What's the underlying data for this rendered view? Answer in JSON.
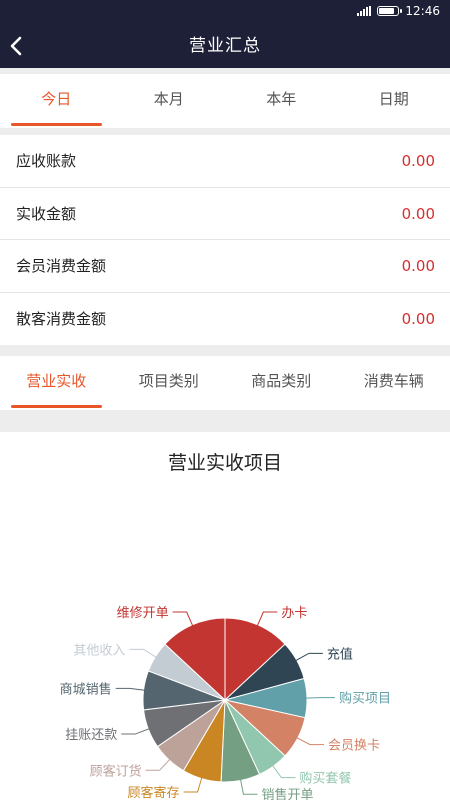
{
  "status": {
    "time": "12:46"
  },
  "header": {
    "title": "营业汇总"
  },
  "date_tabs": [
    {
      "label": "今日",
      "active": true
    },
    {
      "label": "本月",
      "active": false
    },
    {
      "label": "本年",
      "active": false
    },
    {
      "label": "日期",
      "active": false
    }
  ],
  "summary": [
    {
      "label": "应收账款",
      "value": "0.00"
    },
    {
      "label": "实收金额",
      "value": "0.00"
    },
    {
      "label": "会员消费金额",
      "value": "0.00"
    },
    {
      "label": "散客消费金额",
      "value": "0.00"
    }
  ],
  "category_tabs": [
    {
      "label": "营业实收",
      "active": true
    },
    {
      "label": "项目类别",
      "active": false
    },
    {
      "label": "商品类别",
      "active": false
    },
    {
      "label": "消费车辆",
      "active": false
    }
  ],
  "chart_data": {
    "type": "pie",
    "title": "营业实收项目",
    "legend": "none",
    "series": [
      {
        "name": "办卡",
        "value": 17,
        "color": "#c23531"
      },
      {
        "name": "充值",
        "value": 10,
        "color": "#2f4554"
      },
      {
        "name": "购买项目",
        "value": 10,
        "color": "#61a0a8"
      },
      {
        "name": "会员换卡",
        "value": 11,
        "color": "#d48265"
      },
      {
        "name": "购买套餐",
        "value": 8,
        "color": "#91c7ae"
      },
      {
        "name": "销售开单",
        "value": 10,
        "color": "#749f83"
      },
      {
        "name": "顾客寄存",
        "value": 10,
        "color": "#ca8622"
      },
      {
        "name": "顾客订货",
        "value": 9,
        "color": "#bda29a"
      },
      {
        "name": "挂账还款",
        "value": 10,
        "color": "#6e7074"
      },
      {
        "name": "商城销售",
        "value": 10,
        "color": "#546570"
      },
      {
        "name": "其他收入",
        "value": 8,
        "color": "#c4ccd3"
      },
      {
        "name": "维修开单",
        "value": 17,
        "color": "#c23531"
      }
    ]
  }
}
